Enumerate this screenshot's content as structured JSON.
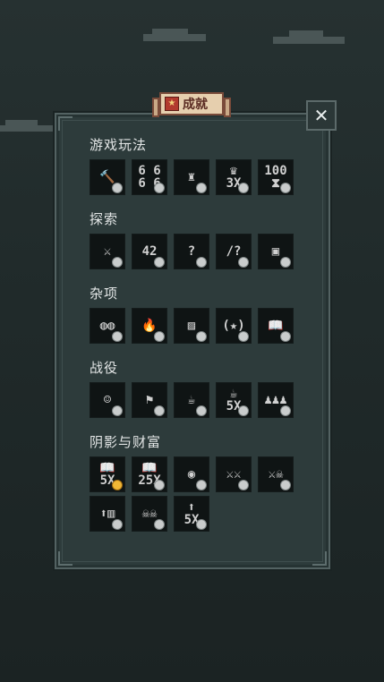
{
  "header": {
    "title": "成就",
    "trophy_glyph": "★",
    "close_glyph": "✕"
  },
  "sections": [
    {
      "title": "游戏玩法",
      "tiles": [
        {
          "name": "hammer-icon",
          "glyph": "🔨",
          "lock": "grey"
        },
        {
          "name": "dice-pyramid-icon",
          "glyph": "6 6\n6 6",
          "lock": "grey"
        },
        {
          "name": "castle-icon",
          "glyph": "♜",
          "lock": "grey"
        },
        {
          "name": "crown-3x-icon",
          "glyph": "♛\n3X",
          "lock": "grey"
        },
        {
          "name": "hourglass-100-icon",
          "glyph": "100\n⧗",
          "lock": "grey"
        }
      ]
    },
    {
      "title": "探索",
      "tiles": [
        {
          "name": "sword-hourglass-icon",
          "glyph": "⚔",
          "lock": "grey"
        },
        {
          "name": "number-42-icon",
          "glyph": "42",
          "lock": "grey"
        },
        {
          "name": "question-icon",
          "glyph": "?",
          "lock": "grey"
        },
        {
          "name": "sword-question-icon",
          "glyph": "/?",
          "lock": "grey"
        },
        {
          "name": "chest-icon",
          "glyph": "▣",
          "lock": "grey"
        }
      ]
    },
    {
      "title": "杂项",
      "tiles": [
        {
          "name": "coin-stacks-icon",
          "glyph": "◍◍",
          "lock": "grey"
        },
        {
          "name": "fire-icon",
          "glyph": "🔥",
          "lock": "grey"
        },
        {
          "name": "painting-icon",
          "glyph": "▨",
          "lock": "grey"
        },
        {
          "name": "laurel-star-icon",
          "glyph": "(★)",
          "lock": "grey"
        },
        {
          "name": "book-icon",
          "glyph": "📖",
          "lock": "grey"
        }
      ]
    },
    {
      "title": "战役",
      "tiles": [
        {
          "name": "bearded-face-icon",
          "glyph": "☺",
          "lock": "grey"
        },
        {
          "name": "map-sword-icon",
          "glyph": "⚑",
          "lock": "grey"
        },
        {
          "name": "mug-icon",
          "glyph": "☕",
          "lock": "grey"
        },
        {
          "name": "mug-5x-icon",
          "glyph": "☕\n5X",
          "lock": "grey"
        },
        {
          "name": "crowd-icon",
          "glyph": "♟♟♟",
          "lock": "grey"
        }
      ]
    },
    {
      "title": "阴影与财富",
      "tiles": [
        {
          "name": "book-5x-icon",
          "glyph": "📖\n5X",
          "lock": "gold"
        },
        {
          "name": "book-25x-icon",
          "glyph": "📖\n25X",
          "lock": "grey"
        },
        {
          "name": "glow-orb-icon",
          "glyph": "◉",
          "lock": "grey"
        },
        {
          "name": "swords-figures-icon",
          "glyph": "⚔⚔",
          "lock": "grey"
        },
        {
          "name": "swords-skulls-icon",
          "glyph": "⚔☠",
          "lock": "grey"
        },
        {
          "name": "arrow-building-icon",
          "glyph": "⬆▥",
          "lock": "grey"
        },
        {
          "name": "skulls-crowd-icon",
          "glyph": "☠☠",
          "lock": "grey"
        },
        {
          "name": "arrow-5x-icon",
          "glyph": "⬆\n5X",
          "lock": "grey"
        }
      ]
    }
  ],
  "colors": {
    "background": "#222c2c",
    "panel": "#2d3b3b",
    "banner": "#e6cfae",
    "gold_badge": "#f0b736"
  }
}
